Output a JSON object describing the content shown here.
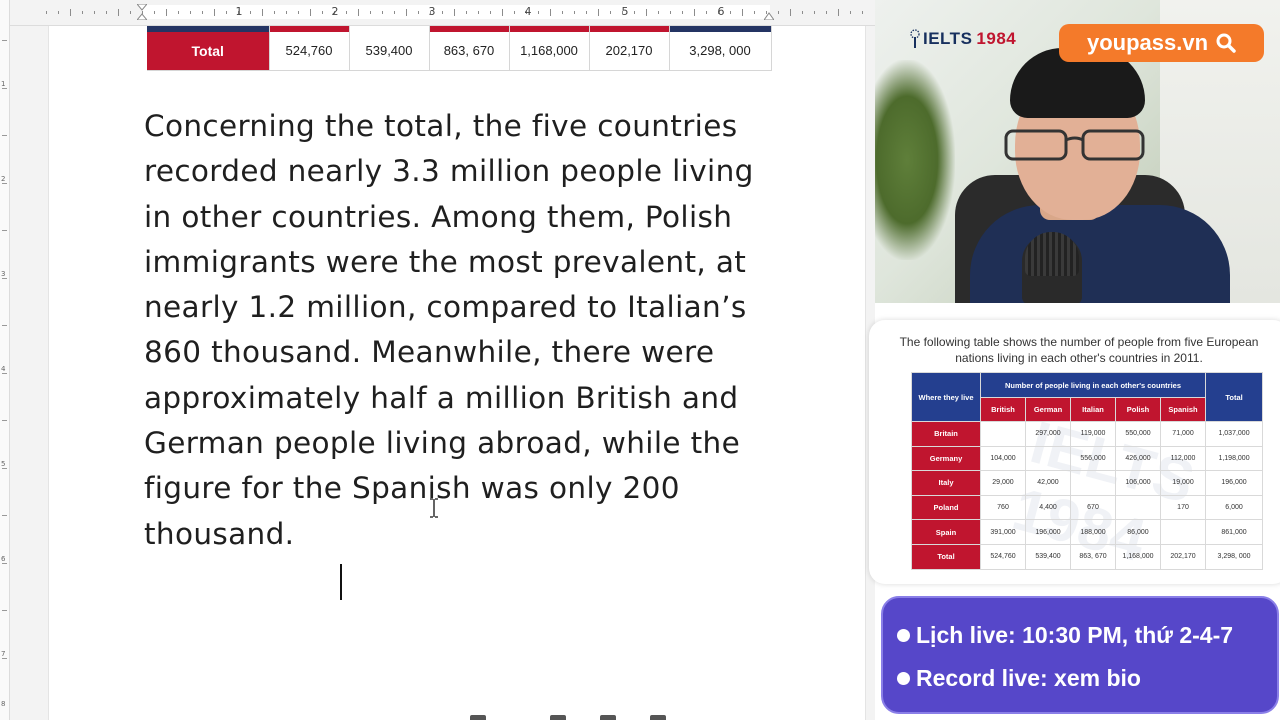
{
  "document": {
    "ruler_numbers": [
      "1",
      "2",
      "3",
      "4",
      "5",
      "6"
    ],
    "vertical_ruler_numbers": [
      "1",
      "2",
      "3",
      "4",
      "5",
      "6",
      "7",
      "8"
    ],
    "table_total_row": {
      "label": "Total",
      "values": [
        "524,760",
        "539,400",
        "863, 670",
        "1,168,000",
        "202,170",
        "3,298, 000"
      ]
    },
    "paragraph": "Concerning the total, the five countries recorded nearly 3.3 million people living in other countries. Among them, Polish immigrants were the most prevalent, at nearly 1.2 million, compared to Italian’s 860 thousand. Meanwhile, there were approximately half a million British and German people living abroad, while the figure for the Spanish was only 200 thousand."
  },
  "right_panel": {
    "logo": {
      "part1": "IELTS",
      "part2": "1984"
    },
    "brand_button": "youpass.vn",
    "table_card": {
      "caption": "The following table shows the number of people from five European nations living in each other's countries in 2011.",
      "header_where": "Where they live",
      "header_group": "Number of people living in each other's countries",
      "header_total": "Total",
      "columns": [
        "British",
        "German",
        "Italian",
        "Polish",
        "Spanish"
      ],
      "rows": [
        {
          "label": "Britain",
          "cells": [
            "",
            "297,000",
            "119,000",
            "550,000",
            "71,000"
          ],
          "total": "1,037,000"
        },
        {
          "label": "Germany",
          "cells": [
            "104,000",
            "",
            "556,000",
            "426,000",
            "112,000"
          ],
          "total": "1,198,000"
        },
        {
          "label": "Italy",
          "cells": [
            "29,000",
            "42,000",
            "",
            "106,000",
            "19,000"
          ],
          "total": "196,000"
        },
        {
          "label": "Poland",
          "cells": [
            "760",
            "4,400",
            "670",
            "",
            "170"
          ],
          "total": "6,000"
        },
        {
          "label": "Spain",
          "cells": [
            "391,000",
            "196,000",
            "188,000",
            "86,000",
            ""
          ],
          "total": "861,000"
        },
        {
          "label": "Total",
          "cells": [
            "524,760",
            "539,400",
            "863, 670",
            "1,168,000",
            "202,170"
          ],
          "total": "3,298, 000"
        }
      ],
      "watermark": "IELTS 1984"
    },
    "schedule": {
      "line1": "Lịch live: 10:30 PM, thứ 2-4-7",
      "line2": "Record live: xem bio"
    }
  },
  "colors": {
    "header_red": "#c0152f",
    "header_navy": "#243f8f",
    "brand_orange": "#f47a2a",
    "schedule_purple": "#5647c9"
  }
}
